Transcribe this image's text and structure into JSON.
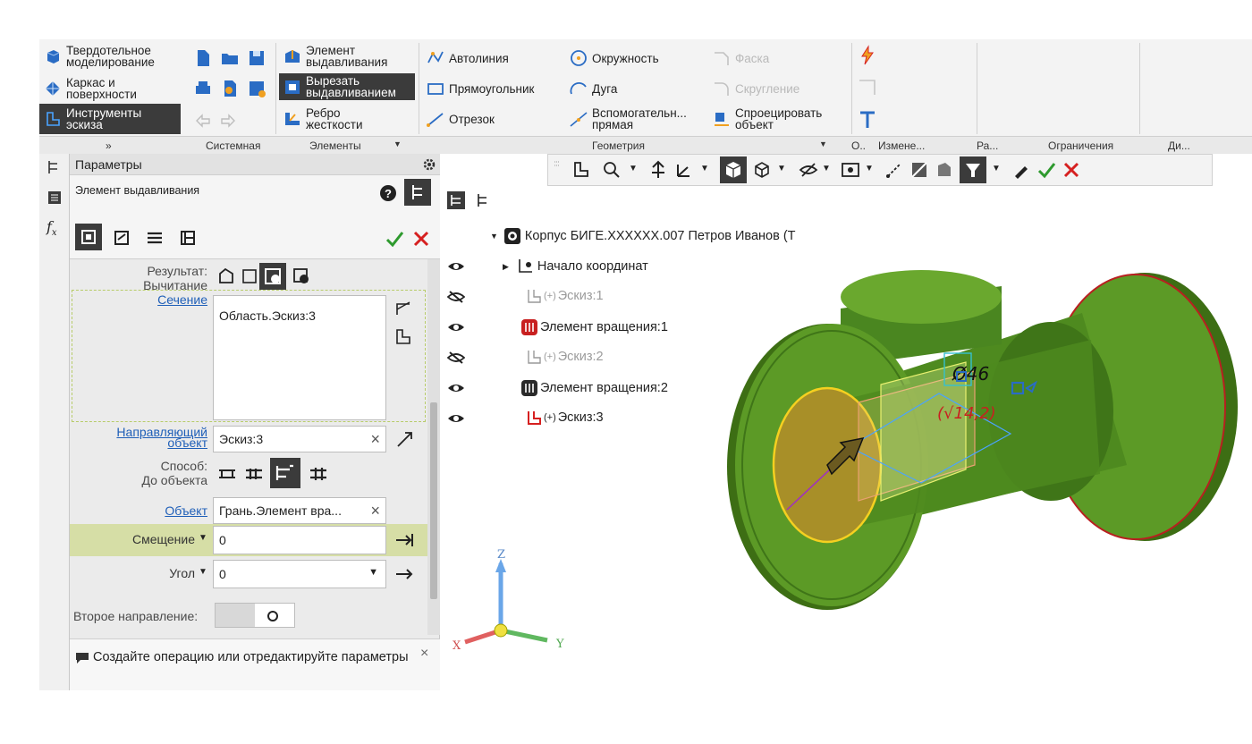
{
  "ribbon": {
    "modes": [
      {
        "label1": "Твердотельное",
        "label2": "моделирование"
      },
      {
        "label1": "Каркас и",
        "label2": "поверхности"
      },
      {
        "label1": "Инструменты",
        "label2": "эскиза"
      }
    ],
    "commands": {
      "extrude": {
        "l1": "Элемент",
        "l2": "выдавливания"
      },
      "cut_extrude": {
        "l1": "Вырезать",
        "l2": "выдавливанием"
      },
      "rib": {
        "l1": "Ребро",
        "l2": "жесткости"
      },
      "autoline": "Автолиния",
      "rectangle": "Прямоугольник",
      "segment": "Отрезок",
      "circle": "Окружность",
      "arc": "Дуга",
      "aux_line": {
        "l1": "Вспомогательн...",
        "l2": "прямая"
      },
      "chamfer": "Фаска",
      "fillet": "Скругление",
      "project": {
        "l1": "Спроецировать",
        "l2": "объект"
      }
    },
    "groups": {
      "system": "Системная",
      "elements": "Элементы",
      "geometry": "Геометрия",
      "o": "О..",
      "change": "Измене...",
      "ra": "Ра...",
      "constraints": "Ограничения",
      "di": "Ди..."
    },
    "chevron": "»"
  },
  "panel": {
    "title": "Параметры",
    "operation": "Элемент выдавливания",
    "result_label": "Результат:",
    "result_value": "Вычитание",
    "section_label": "Сечение",
    "section_value": "Область.Эскиз:3",
    "guide_label1": "Направляющий",
    "guide_label2": "объект",
    "guide_value": "Эскиз:3",
    "method_label": "Способ:",
    "method_value": "До объекта",
    "object_label": "Объект",
    "object_value": "Грань.Элемент вра...",
    "offset_label": "Смещение",
    "offset_value": "0",
    "angle_label": "Угол",
    "angle_value": "0",
    "second_dir_label": "Второе направление:",
    "tip": "Создайте операцию или отредактируйте параметры"
  },
  "tree": {
    "root": "Корпус БИГЕ.XXXXXX.007 Петров Иванов (Т",
    "items": [
      {
        "label": "Начало координат",
        "prefix": ""
      },
      {
        "label": "Эскиз:1",
        "prefix": "(+)"
      },
      {
        "label": "Элемент вращения:1",
        "prefix": ""
      },
      {
        "label": "Эскиз:2",
        "prefix": "(+)"
      },
      {
        "label": "Элемент вращения:2",
        "prefix": ""
      },
      {
        "label": "Эскиз:3",
        "prefix": "(+)"
      }
    ]
  },
  "triad": {
    "x": "X",
    "y": "Y",
    "z": "Z"
  },
  "model_text": {
    "dim1": "Ø46",
    "dim2": "(√14,2)"
  },
  "colors": {
    "green": "#4f8a1e",
    "accent_red": "#d62020",
    "accent_green": "#2e9a2e",
    "dark": "#3b3b3b"
  }
}
